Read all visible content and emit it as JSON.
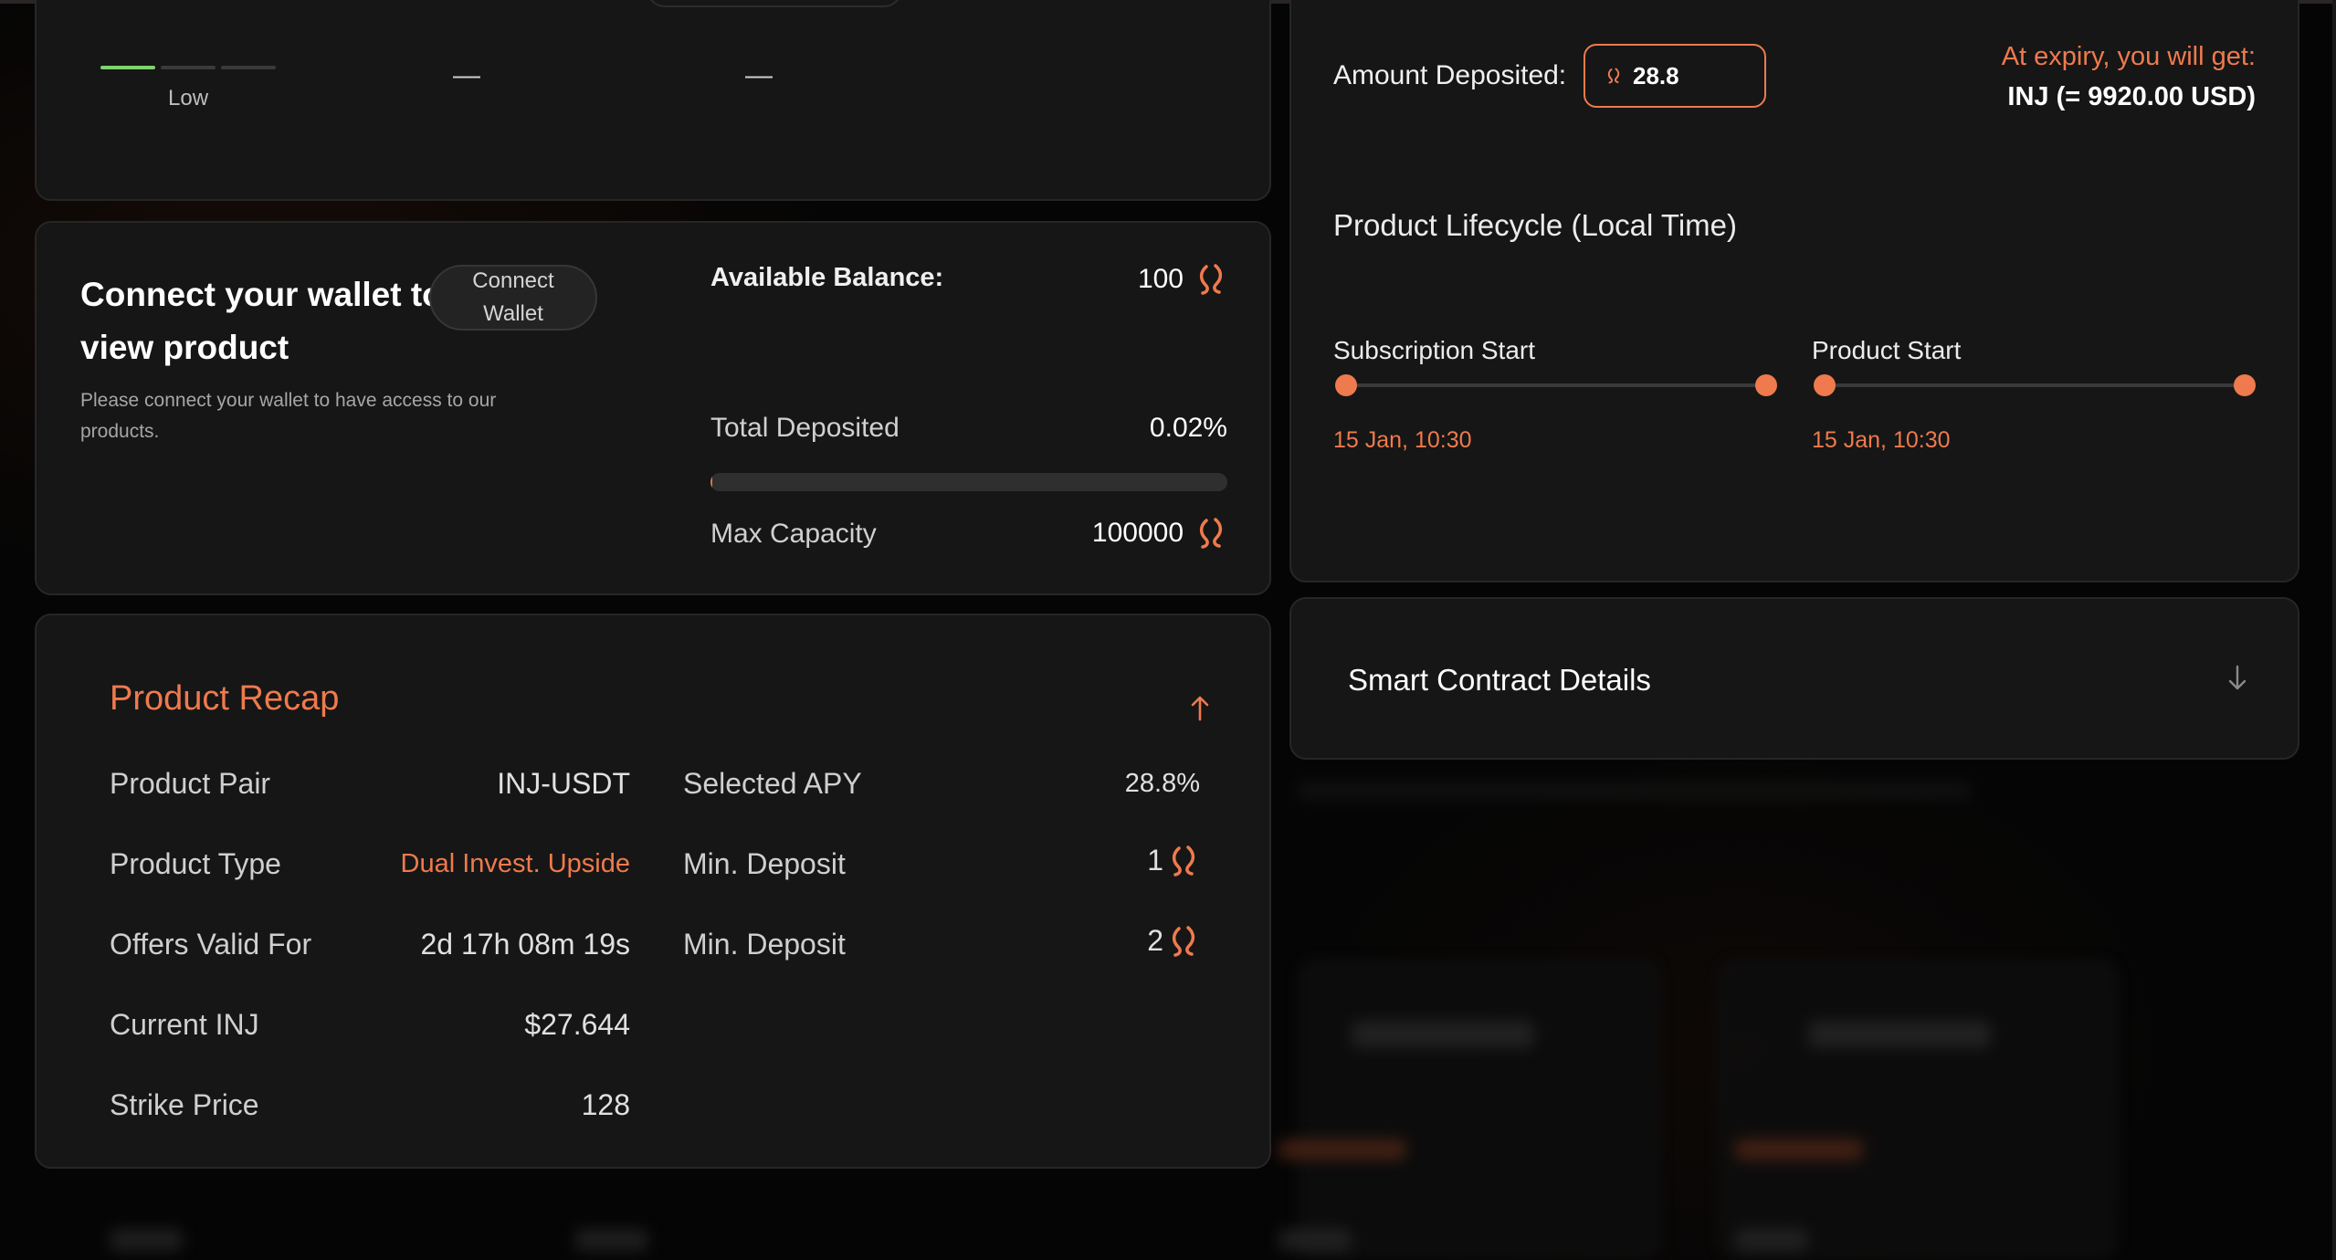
{
  "risk": {
    "level_label": "Low",
    "dash_1": "—",
    "dash_2": "—"
  },
  "wallet": {
    "title": "Connect your wallet to view product",
    "connect_button": "Connect Wallet",
    "description": "Please connect your wallet to have access to our products.",
    "available_balance_label": "Available Balance:",
    "available_balance_value": "100",
    "total_deposited_label": "Total Deposited",
    "total_deposited_value": "0.02%",
    "total_deposited_fraction": 0.0002,
    "max_capacity_label": "Max Capacity",
    "max_capacity_value": "100000"
  },
  "recap": {
    "title": "Product Recap",
    "left_rows": [
      {
        "label": "Product Pair",
        "value": "INJ-USDT"
      },
      {
        "label": "Product Type",
        "value": "Dual Invest. Upside"
      },
      {
        "label": "Offers Valid For",
        "value": "2d 17h 08m 19s"
      },
      {
        "label": "Current INJ",
        "value": "$27.644"
      },
      {
        "label": "Strike Price",
        "value": "128"
      }
    ],
    "right_rows": [
      {
        "label": "Selected APY",
        "value": "28.8%"
      },
      {
        "label": "Min. Deposit",
        "value": "1"
      },
      {
        "label": "Min. Deposit",
        "value": "2"
      }
    ]
  },
  "expiry": {
    "amount_label": "Amount Deposited:",
    "amount_value": "28.8",
    "expiry_label": "At expiry, you will get:",
    "expiry_value": "INJ (= 9920.00 USD)",
    "lifecycle_title": "Product Lifecycle (Local Time)",
    "phases": [
      {
        "label": "Subscription Start",
        "date": "15 Jan, 10:30"
      },
      {
        "label": "Product Start",
        "date": "15 Jan, 10:30"
      }
    ]
  },
  "contract": {
    "title": "Smart Contract Details"
  },
  "colors": {
    "accent": "#ef7a4d",
    "risk_low": "#7ed36b",
    "card_bg": "#161616"
  },
  "icons": {
    "token": "injective-token-icon",
    "collapse": "arrow-up-icon",
    "expand": "arrow-down-icon"
  }
}
